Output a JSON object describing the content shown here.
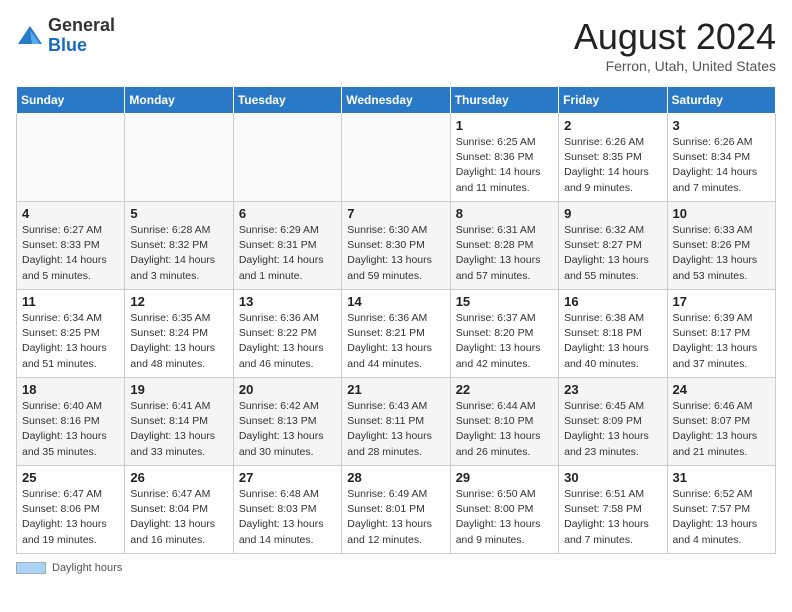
{
  "header": {
    "logo_general": "General",
    "logo_blue": "Blue",
    "month_title": "August 2024",
    "location": "Ferron, Utah, United States"
  },
  "days_of_week": [
    "Sunday",
    "Monday",
    "Tuesday",
    "Wednesday",
    "Thursday",
    "Friday",
    "Saturday"
  ],
  "footer": {
    "label": "Daylight hours"
  },
  "weeks": [
    [
      {
        "day": "",
        "info": ""
      },
      {
        "day": "",
        "info": ""
      },
      {
        "day": "",
        "info": ""
      },
      {
        "day": "",
        "info": ""
      },
      {
        "day": "1",
        "info": "Sunrise: 6:25 AM\nSunset: 8:36 PM\nDaylight: 14 hours and 11 minutes."
      },
      {
        "day": "2",
        "info": "Sunrise: 6:26 AM\nSunset: 8:35 PM\nDaylight: 14 hours and 9 minutes."
      },
      {
        "day": "3",
        "info": "Sunrise: 6:26 AM\nSunset: 8:34 PM\nDaylight: 14 hours and 7 minutes."
      }
    ],
    [
      {
        "day": "4",
        "info": "Sunrise: 6:27 AM\nSunset: 8:33 PM\nDaylight: 14 hours and 5 minutes."
      },
      {
        "day": "5",
        "info": "Sunrise: 6:28 AM\nSunset: 8:32 PM\nDaylight: 14 hours and 3 minutes."
      },
      {
        "day": "6",
        "info": "Sunrise: 6:29 AM\nSunset: 8:31 PM\nDaylight: 14 hours and 1 minute."
      },
      {
        "day": "7",
        "info": "Sunrise: 6:30 AM\nSunset: 8:30 PM\nDaylight: 13 hours and 59 minutes."
      },
      {
        "day": "8",
        "info": "Sunrise: 6:31 AM\nSunset: 8:28 PM\nDaylight: 13 hours and 57 minutes."
      },
      {
        "day": "9",
        "info": "Sunrise: 6:32 AM\nSunset: 8:27 PM\nDaylight: 13 hours and 55 minutes."
      },
      {
        "day": "10",
        "info": "Sunrise: 6:33 AM\nSunset: 8:26 PM\nDaylight: 13 hours and 53 minutes."
      }
    ],
    [
      {
        "day": "11",
        "info": "Sunrise: 6:34 AM\nSunset: 8:25 PM\nDaylight: 13 hours and 51 minutes."
      },
      {
        "day": "12",
        "info": "Sunrise: 6:35 AM\nSunset: 8:24 PM\nDaylight: 13 hours and 48 minutes."
      },
      {
        "day": "13",
        "info": "Sunrise: 6:36 AM\nSunset: 8:22 PM\nDaylight: 13 hours and 46 minutes."
      },
      {
        "day": "14",
        "info": "Sunrise: 6:36 AM\nSunset: 8:21 PM\nDaylight: 13 hours and 44 minutes."
      },
      {
        "day": "15",
        "info": "Sunrise: 6:37 AM\nSunset: 8:20 PM\nDaylight: 13 hours and 42 minutes."
      },
      {
        "day": "16",
        "info": "Sunrise: 6:38 AM\nSunset: 8:18 PM\nDaylight: 13 hours and 40 minutes."
      },
      {
        "day": "17",
        "info": "Sunrise: 6:39 AM\nSunset: 8:17 PM\nDaylight: 13 hours and 37 minutes."
      }
    ],
    [
      {
        "day": "18",
        "info": "Sunrise: 6:40 AM\nSunset: 8:16 PM\nDaylight: 13 hours and 35 minutes."
      },
      {
        "day": "19",
        "info": "Sunrise: 6:41 AM\nSunset: 8:14 PM\nDaylight: 13 hours and 33 minutes."
      },
      {
        "day": "20",
        "info": "Sunrise: 6:42 AM\nSunset: 8:13 PM\nDaylight: 13 hours and 30 minutes."
      },
      {
        "day": "21",
        "info": "Sunrise: 6:43 AM\nSunset: 8:11 PM\nDaylight: 13 hours and 28 minutes."
      },
      {
        "day": "22",
        "info": "Sunrise: 6:44 AM\nSunset: 8:10 PM\nDaylight: 13 hours and 26 minutes."
      },
      {
        "day": "23",
        "info": "Sunrise: 6:45 AM\nSunset: 8:09 PM\nDaylight: 13 hours and 23 minutes."
      },
      {
        "day": "24",
        "info": "Sunrise: 6:46 AM\nSunset: 8:07 PM\nDaylight: 13 hours and 21 minutes."
      }
    ],
    [
      {
        "day": "25",
        "info": "Sunrise: 6:47 AM\nSunset: 8:06 PM\nDaylight: 13 hours and 19 minutes."
      },
      {
        "day": "26",
        "info": "Sunrise: 6:47 AM\nSunset: 8:04 PM\nDaylight: 13 hours and 16 minutes."
      },
      {
        "day": "27",
        "info": "Sunrise: 6:48 AM\nSunset: 8:03 PM\nDaylight: 13 hours and 14 minutes."
      },
      {
        "day": "28",
        "info": "Sunrise: 6:49 AM\nSunset: 8:01 PM\nDaylight: 13 hours and 12 minutes."
      },
      {
        "day": "29",
        "info": "Sunrise: 6:50 AM\nSunset: 8:00 PM\nDaylight: 13 hours and 9 minutes."
      },
      {
        "day": "30",
        "info": "Sunrise: 6:51 AM\nSunset: 7:58 PM\nDaylight: 13 hours and 7 minutes."
      },
      {
        "day": "31",
        "info": "Sunrise: 6:52 AM\nSunset: 7:57 PM\nDaylight: 13 hours and 4 minutes."
      }
    ]
  ]
}
